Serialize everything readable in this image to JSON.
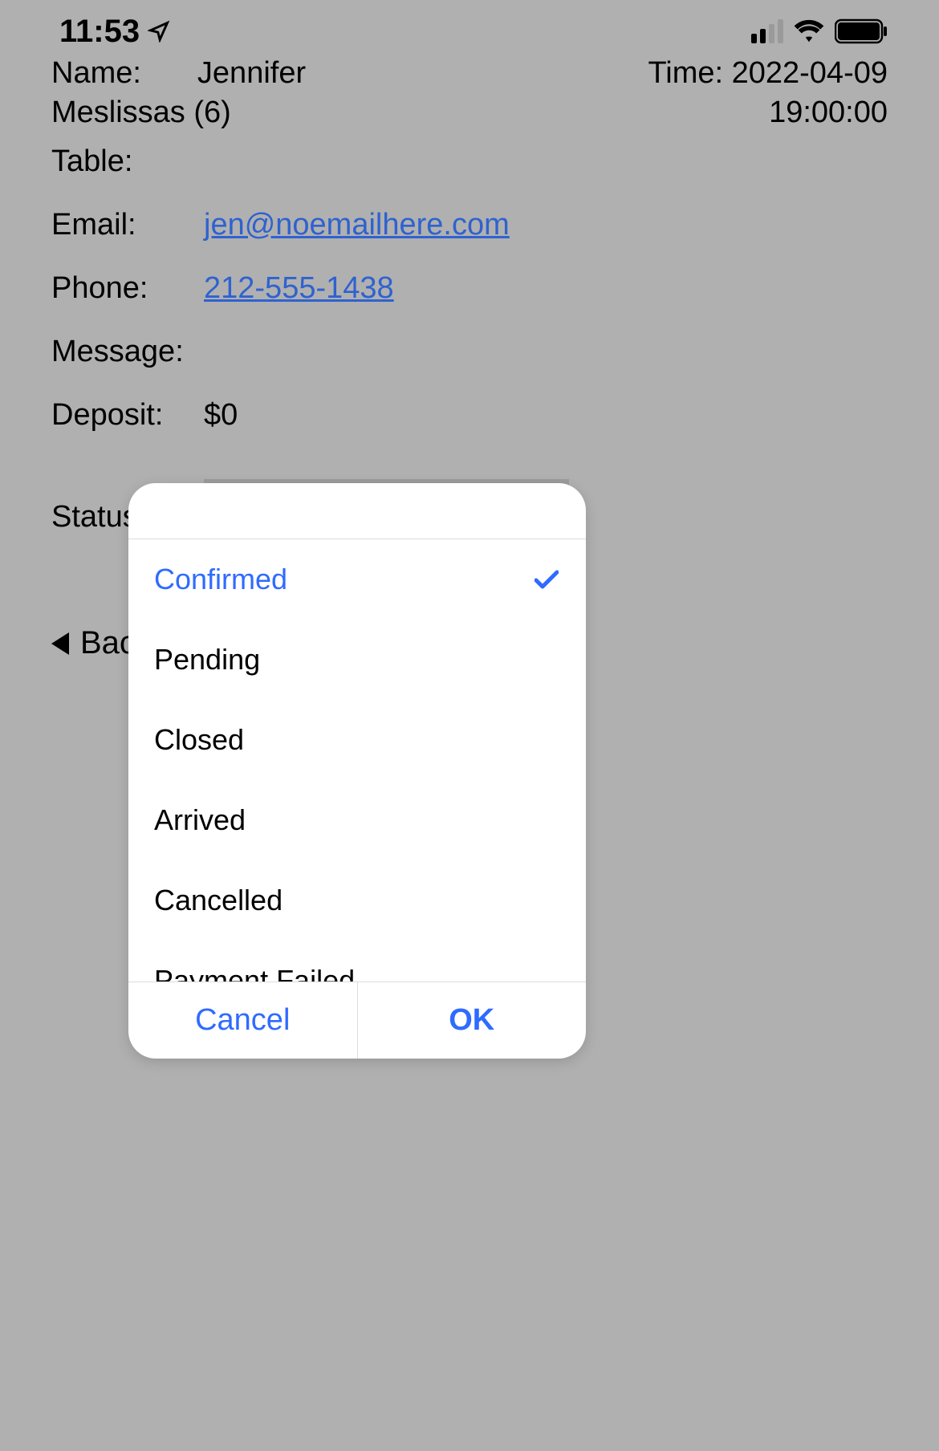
{
  "status_bar": {
    "time": "11:53"
  },
  "reservation": {
    "name_label": "Name:",
    "name_value_first": "Jennifer",
    "name_value_rest": "Meslissas (6)",
    "time_label": "Time:",
    "time_value_date": "2022-04-09",
    "time_value_time": "19:00:00",
    "table_label": "Table:",
    "table_value": "",
    "email_label": "Email:",
    "email_value": "jen@noemailhere.com",
    "phone_label": "Phone:",
    "phone_value": "212-555-1438",
    "message_label": "Message:",
    "message_value": "",
    "deposit_label": "Deposit:",
    "deposit_value": "$0",
    "status_label": "Status:",
    "status_value": "Confirmed"
  },
  "nav": {
    "back_label": "Back"
  },
  "popup": {
    "options": {
      "o0": "Confirmed",
      "o1": "Pending",
      "o2": "Closed",
      "o3": "Arrived",
      "o4": "Cancelled",
      "o5": "Payment Failed"
    },
    "cancel_label": "Cancel",
    "ok_label": "OK"
  }
}
